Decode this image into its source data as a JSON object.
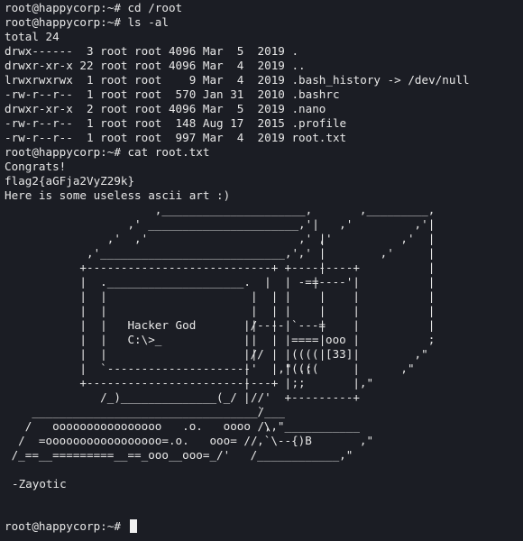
{
  "session": {
    "lines": [
      "root@happycorp:~# cd /root",
      "root@happycorp:~# ls -al",
      "total 24",
      "drwx------  3 root root 4096 Mar  5  2019 .",
      "drwxr-xr-x 22 root root 4096 Mar  4  2019 ..",
      "lrwxrwxrwx  1 root root    9 Mar  4  2019 .bash_history -> /dev/null",
      "-rw-r--r--  1 root root  570 Jan 31  2010 .bashrc",
      "drwxr-xr-x  2 root root 4096 Mar  5  2019 .nano",
      "-rw-r--r--  1 root root  148 Aug 17  2015 .profile",
      "-rw-r--r--  1 root root  997 Mar  4  2019 root.txt",
      "root@happycorp:~# cat root.txt",
      "Congrats!",
      "flag2{aGFja2VyZ29k}",
      "Here is some useless ascii art :)"
    ],
    "ascii_art": "                      ,_____________________,\n                  ,' ______________________,'|\n               ,'  ,'                      ,' |\n            ,'___________________________,'   |\n           +---------------------------+      |\n           |  .____________________.  |      |\n           |  |                     |  |      |\n           |  |                     |  |      |\n           |  |   Hacker God        |  |      |\n           |  |   C:\\>_             |  |      |\n           |  |                     |  |      |\n           |  `---------------------'  |,\" .;\n           +---------------------------+  ;;\n              /_)______________(_/  //'\n    _________________________________/___\n   /   oooooooooooooooo   .o.   oooo /,\n  /  =ooooooooooooooooo=.o.   ooo= //\n /_==__=========__==_ooo__ooo=_/'",
    "ascii_art_right": "                 ,_________,\n              ,'         ,'|\n           ,'          ,'  |\n        ,'          ,'     |\n      +---------+          |\n      | -==----'|          |\n      |         |          |\n      |         |          |\n|/----|`---=    |          |\n|     |==== ooo |          ;\n|//   |(((( [33]|        ,\"\n|     |((((     |      ,\"\n|     |         |,\"\n|     +---------+\n  `\n   \\,\"___________\n  ,`\\--{)B       ,\"\n /____________,\"",
    "signature": "-Zayotic",
    "prompt": "root@happycorp:~# "
  }
}
